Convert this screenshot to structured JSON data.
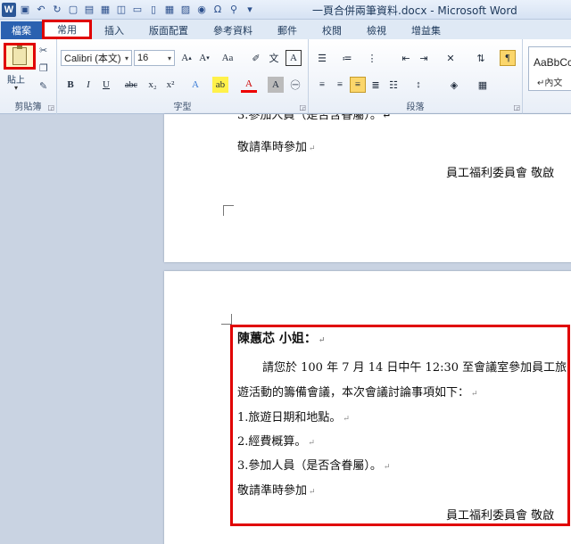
{
  "window": {
    "title": "一頁合併兩筆資料.docx - Microsoft Word"
  },
  "tabs": [
    {
      "label": "檔案"
    },
    {
      "label": "常用"
    },
    {
      "label": "插入"
    },
    {
      "label": "版面配置"
    },
    {
      "label": "參考資料"
    },
    {
      "label": "郵件"
    },
    {
      "label": "校閱"
    },
    {
      "label": "檢視"
    },
    {
      "label": "增益集"
    }
  ],
  "ribbon": {
    "clipboard": {
      "paste_label": "貼上",
      "group_label": "剪貼簿"
    },
    "font": {
      "font_name": "Calibri (本文)",
      "font_size": "16",
      "group_label": "字型"
    },
    "paragraph": {
      "group_label": "段落"
    },
    "styles": {
      "sample": "AaBbCc",
      "style_name": "↵內文"
    }
  },
  "document": {
    "page1": {
      "line1": "3.參加人員（是否含眷屬）。↵",
      "line2": "敬請準時參加",
      "signature": "員工福利委員會 敬啟"
    },
    "page2": {
      "greeting": "陳蕙芯 小姐：",
      "body1": "請您於 100 年 7 月 14 日中午 12:30 至會議室參加員工旅",
      "body2": "遊活動的籌備會議，本次會議討論事項如下：",
      "item1": "1.旅遊日期和地點。",
      "item2": "2.經費概算。",
      "item3": "3.參加人員（是否含眷屬）。",
      "closing": "敬請準時參加",
      "signature": "員工福利委員會 敬啟"
    },
    "paragraph_mark": "↵"
  }
}
